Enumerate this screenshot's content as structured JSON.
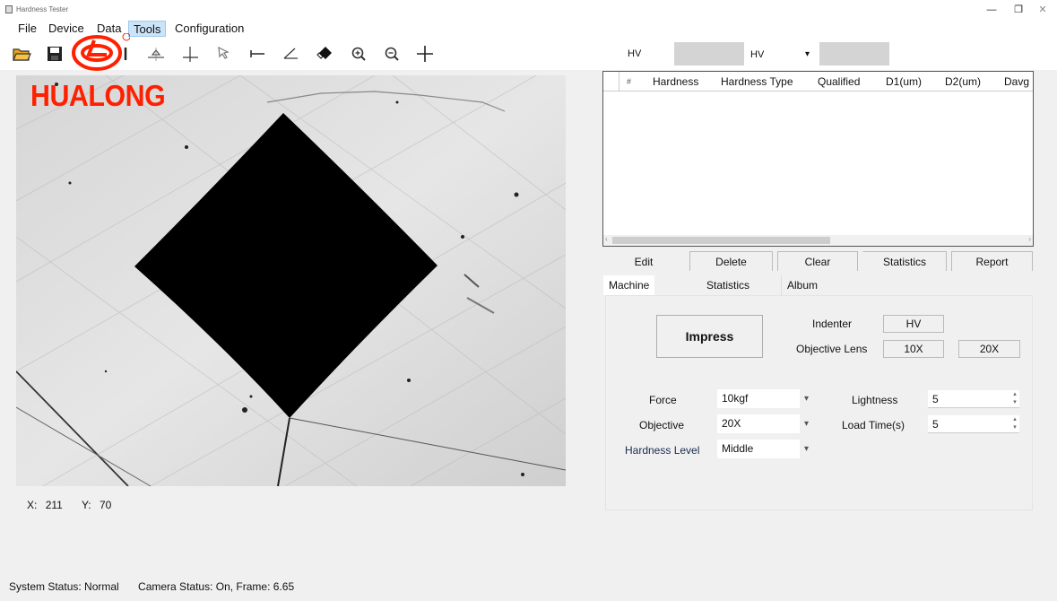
{
  "window": {
    "title": "Hardness Tester",
    "controls": {
      "minimize": "—",
      "maximize": "❐",
      "close": "✕"
    }
  },
  "menu": {
    "items": [
      {
        "label": "File"
      },
      {
        "label": "Device"
      },
      {
        "label": "Data"
      },
      {
        "label": "Tools",
        "active": true
      },
      {
        "label": "Configuration"
      }
    ]
  },
  "toolbar": {
    "icons": [
      "open-folder-icon",
      "save-icon",
      "logo-overlay",
      "line-tool-icon",
      "center-point-icon",
      "perpendicular-icon",
      "select-cursor-icon",
      "horizontal-measure-icon",
      "angle-icon",
      "eraser-icon",
      "zoom-in-icon",
      "zoom-out-icon",
      "crosshair-icon"
    ]
  },
  "brand": {
    "name": "HUALONG",
    "color": "#ff2000",
    "registered": "®"
  },
  "image": {
    "description": "Vickers diamond indentation on metallic surface"
  },
  "cursor": {
    "x_label": "X:",
    "x_value": "211",
    "y_label": "Y:",
    "y_value": "70"
  },
  "status": {
    "system": "System Status: Normal",
    "camera": "Camera Status: On, Frame: 6.65"
  },
  "hardness_bar": {
    "unit_label": "HV",
    "type_select": "HV",
    "arrow": "▾"
  },
  "results_table": {
    "columns": [
      "#",
      "Hardness",
      "Hardness Type",
      "Qualified",
      "D1(um)",
      "D2(um)",
      "Davg"
    ],
    "rows": []
  },
  "actions": {
    "edit": "Edit",
    "delete": "Delete",
    "clear": "Clear",
    "statistics": "Statistics",
    "report": "Report"
  },
  "tabs": [
    {
      "label": "Machine Control",
      "active": true
    },
    {
      "label": "Statistics Info"
    },
    {
      "label": "Album"
    }
  ],
  "machine_control": {
    "impress": "Impress",
    "indenter_label": "Indenter",
    "indenter_value": "HV",
    "objective_lens_label": "Objective Lens",
    "lens_10x": "10X",
    "lens_20x": "20X",
    "force_label": "Force",
    "force_value": "10kgf",
    "objective_label": "Objective",
    "objective_value": "20X",
    "hardness_level_label": "Hardness Level",
    "hardness_level_value": "Middle",
    "lightness_label": "Lightness",
    "lightness_value": "5",
    "load_time_label": "Load Time(s)",
    "load_time_value": "5",
    "dropdown_arrow": "▾"
  }
}
